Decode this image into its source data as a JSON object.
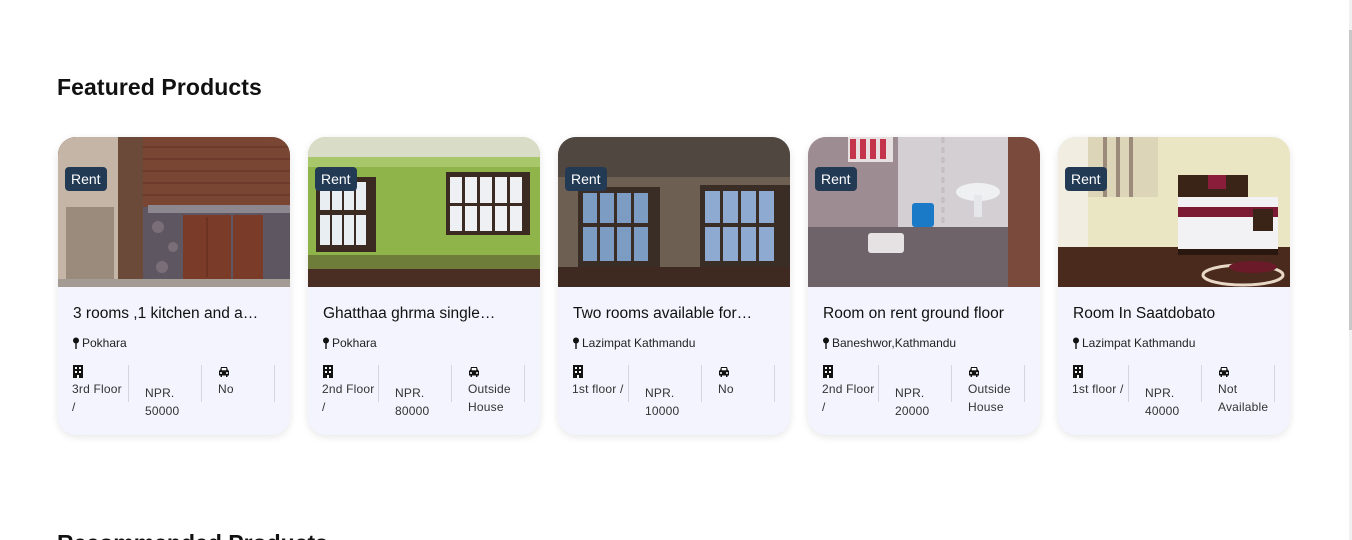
{
  "section": {
    "title": "Featured Products"
  },
  "next_section": {
    "title": "Recommended Products"
  },
  "colors": {
    "badge": "#233a55",
    "card_bg": "#f3f4fd",
    "divider": "#d3d5e3"
  },
  "products": [
    {
      "badge": "Rent",
      "title": "3 rooms ,1 kitchen and a…",
      "location": "Pokhara",
      "floor": "3rd Floor /",
      "price": "NPR. 50000",
      "parking": "No",
      "image": "kitchen-photo"
    },
    {
      "badge": "Rent",
      "title": "Ghatthaa ghrma single…",
      "location": "Pokhara",
      "floor": "2nd Floor /",
      "price": "NPR. 80000",
      "parking": "Outside House",
      "image": "green-room-photo"
    },
    {
      "badge": "Rent",
      "title": "Two rooms available for…",
      "location": "Lazimpat Kathmandu",
      "floor": "1st floor /",
      "price": "NPR. 10000",
      "parking": "No",
      "image": "empty-room-photo"
    },
    {
      "badge": "Rent",
      "title": "Room on rent ground floor",
      "location": "Baneshwor,Kathmandu",
      "floor": "2nd Floor /",
      "price": "NPR. 20000",
      "parking": "Outside House",
      "image": "bathroom-photo"
    },
    {
      "badge": "Rent",
      "title": "Room In Saatdobato",
      "location": "Lazimpat Kathmandu",
      "floor": "1st floor /",
      "price": "NPR. 40000",
      "parking": "Not Available",
      "image": "bedroom-photo"
    }
  ],
  "icons": {
    "location": "map-pin-icon",
    "floor": "building-icon",
    "parking": "car-icon"
  }
}
